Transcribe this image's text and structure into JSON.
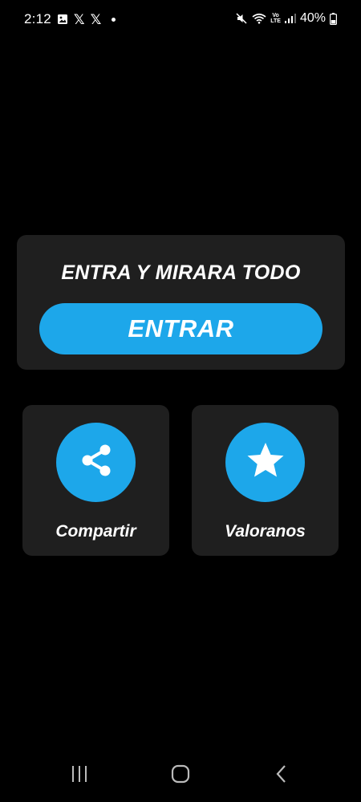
{
  "status_bar": {
    "time": "2:12",
    "battery_percent": "40%",
    "battery_level": 0.4,
    "network_label": "Vo LTE",
    "icons": [
      "gallery-icon",
      "x-logo-icon",
      "x-logo-icon",
      "notification-dot",
      "mute-icon",
      "wifi-icon",
      "volte-icon",
      "signal-icon",
      "battery-icon"
    ]
  },
  "entry_card": {
    "title": "ENTRA Y MIRARA TODO",
    "button_label": "ENTRAR"
  },
  "actions": {
    "share": {
      "label": "Compartir",
      "icon": "share-icon"
    },
    "rate": {
      "label": "Valoranos",
      "icon": "star-icon"
    }
  },
  "nav_bar": {
    "icons": [
      "recents-icon",
      "home-icon",
      "back-icon"
    ]
  },
  "colors": {
    "background": "#000000",
    "card": "#1f1f1f",
    "accent": "#1da7ea",
    "text": "#ffffff"
  }
}
